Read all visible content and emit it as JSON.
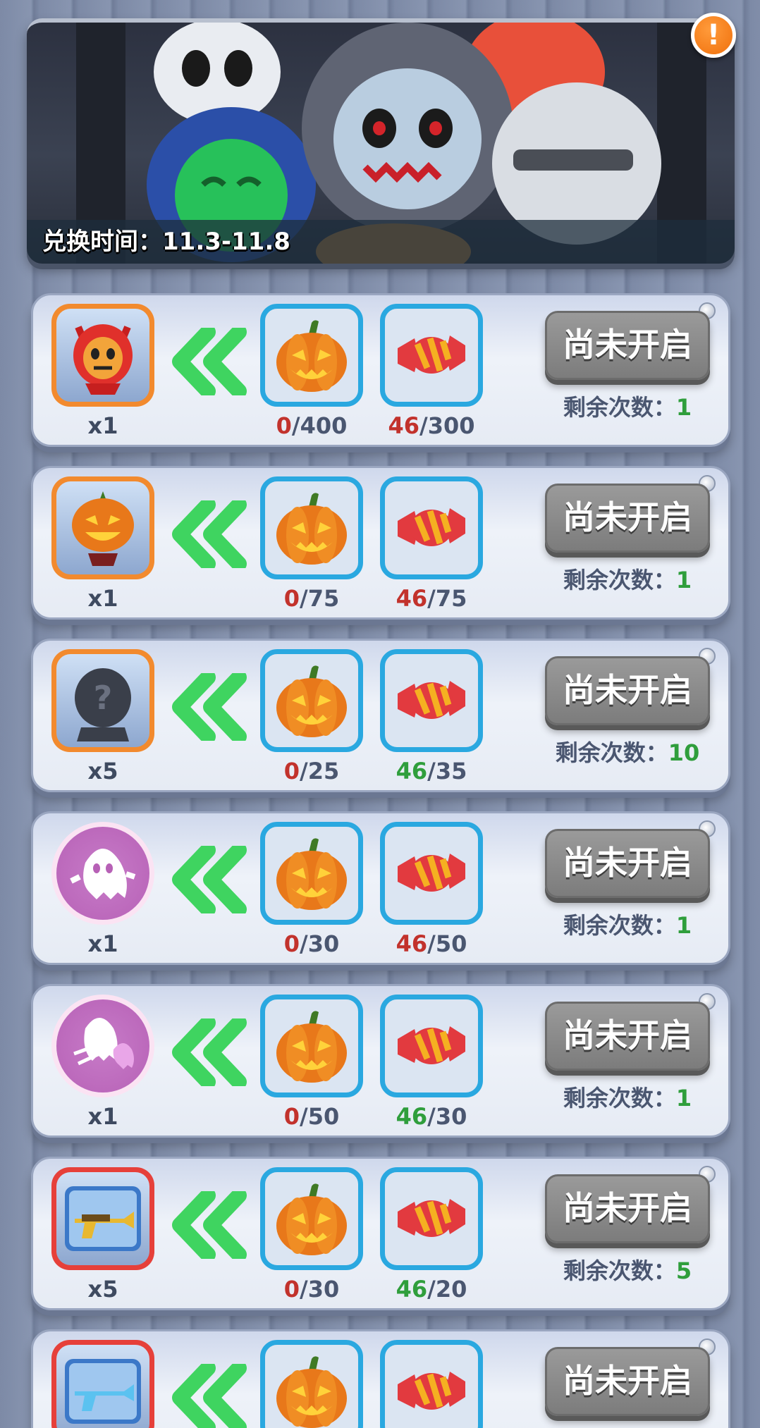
{
  "banner": {
    "text": "兑换时间：11.3-11.8",
    "alert_symbol": "!"
  },
  "colors": {
    "cost_border": "#2aa8e0",
    "chevron": "#4cd964",
    "have_insufficient": "#c2322c",
    "have_sufficient": "#2f9e3c",
    "button_disabled": "#8a8a8a",
    "alert": "#f0700c"
  },
  "cost_icons": [
    "jack-o-lantern-icon",
    "striped-candy-icon"
  ],
  "rows": [
    {
      "reward_icon": "red-devil-hood-icon",
      "reward_frame": "orange",
      "qty": "x1",
      "pumpkin_have": "0",
      "pumpkin_need": "/400",
      "pumpkin_state": "red",
      "candy_have": "46",
      "candy_need": "/300",
      "candy_state": "red",
      "button": "尚未开启",
      "remain_label": "剩余次数：",
      "remain_value": "1"
    },
    {
      "reward_icon": "pumpkin-head-icon",
      "reward_frame": "orange",
      "qty": "x1",
      "pumpkin_have": "0",
      "pumpkin_need": "/75",
      "pumpkin_state": "red",
      "candy_have": "46",
      "candy_need": "/75",
      "candy_state": "red",
      "button": "尚未开启",
      "remain_label": "剩余次数：",
      "remain_value": "1"
    },
    {
      "reward_icon": "mystery-character-icon",
      "reward_frame": "orange",
      "qty": "x5",
      "pumpkin_have": "0",
      "pumpkin_need": "/25",
      "pumpkin_state": "red",
      "candy_have": "46",
      "candy_need": "/35",
      "candy_state": "green",
      "button": "尚未开启",
      "remain_label": "剩余次数：",
      "remain_value": "10"
    },
    {
      "reward_icon": "ghost-emote-icon",
      "reward_frame": "round",
      "qty": "x1",
      "pumpkin_have": "0",
      "pumpkin_need": "/30",
      "pumpkin_state": "red",
      "candy_have": "46",
      "candy_need": "/50",
      "candy_state": "red",
      "button": "尚未开启",
      "remain_label": "剩余次数：",
      "remain_value": "1"
    },
    {
      "reward_icon": "ghost-trail-icon",
      "reward_frame": "round",
      "qty": "x1",
      "pumpkin_have": "0",
      "pumpkin_need": "/50",
      "pumpkin_state": "red",
      "candy_have": "46",
      "candy_need": "/30",
      "candy_state": "green",
      "button": "尚未开启",
      "remain_label": "剩余次数：",
      "remain_value": "1"
    },
    {
      "reward_icon": "golden-gun-card-icon",
      "reward_frame": "red",
      "qty": "x5",
      "pumpkin_have": "0",
      "pumpkin_need": "/30",
      "pumpkin_state": "red",
      "candy_have": "46",
      "candy_need": "/20",
      "candy_state": "green",
      "button": "尚未开启",
      "remain_label": "剩余次数：",
      "remain_value": "5"
    },
    {
      "reward_icon": "blue-gun-card-icon",
      "reward_frame": "red",
      "qty": "",
      "pumpkin_have": "",
      "pumpkin_need": "",
      "pumpkin_state": "red",
      "candy_have": "",
      "candy_need": "",
      "candy_state": "red",
      "button": "尚未开启",
      "remain_label": "",
      "remain_value": ""
    }
  ]
}
